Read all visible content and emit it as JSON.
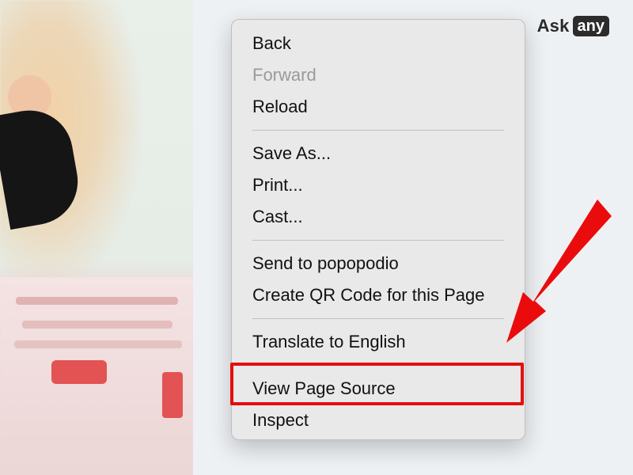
{
  "logo": {
    "ask": "Ask",
    "any": "any"
  },
  "context_menu": {
    "items": [
      {
        "label": "Back",
        "disabled": false
      },
      {
        "label": "Forward",
        "disabled": true
      },
      {
        "label": "Reload",
        "disabled": false
      },
      {
        "separator": true
      },
      {
        "label": "Save As...",
        "disabled": false
      },
      {
        "label": "Print...",
        "disabled": false
      },
      {
        "label": "Cast...",
        "disabled": false
      },
      {
        "separator": true
      },
      {
        "label": "Send to popopodio",
        "disabled": false
      },
      {
        "label": "Create QR Code for this Page",
        "disabled": false
      },
      {
        "separator": true
      },
      {
        "label": "Translate to English",
        "disabled": false
      },
      {
        "separator": true
      },
      {
        "label": "View Page Source",
        "disabled": false,
        "highlighted": true
      },
      {
        "label": "Inspect",
        "disabled": false
      }
    ]
  },
  "colors": {
    "menu_background": "#e9e9e9",
    "disabled_text": "#9a9a9a",
    "highlight_red": "#e20f0f",
    "page_background": "#eef1f4"
  },
  "icons": {
    "arrow": "red-arrow-icon"
  }
}
